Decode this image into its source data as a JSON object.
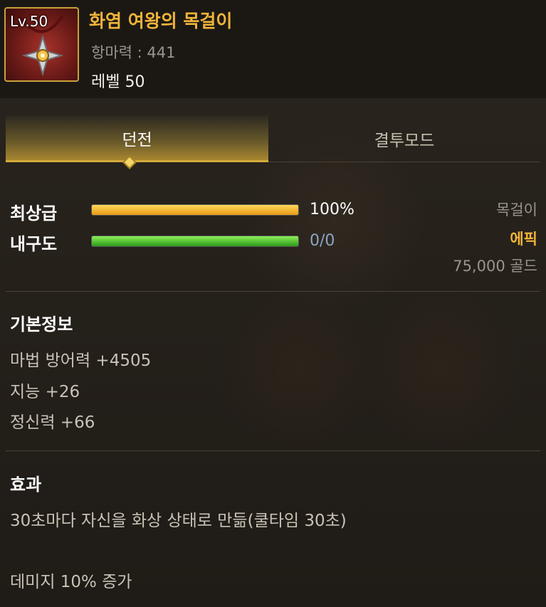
{
  "item": {
    "level_badge": "Lv.50",
    "name": "화염 여왕의 목걸이",
    "resist": "항마력 : 441",
    "level": "레벨 50"
  },
  "tabs": [
    {
      "label": "던전",
      "active": true
    },
    {
      "label": "결투모드",
      "active": false
    }
  ],
  "stats": {
    "top_grade": {
      "label": "최상급",
      "value": "100%",
      "fraction": 1.0,
      "color": "#f0a020"
    },
    "durability": {
      "label": "내구도",
      "value": "0/0",
      "fraction": 1.0,
      "color": "#54d030"
    }
  },
  "info": {
    "type": "목걸이",
    "rarity": "에픽",
    "price": "75,000 골드"
  },
  "basic_info": {
    "title": "기본정보",
    "lines": [
      "마법 방어력 +4505",
      "지능 +26",
      "정신력 +66"
    ]
  },
  "effect": {
    "title": "효과",
    "lines": [
      "30초마다 자신을 화상 상태로 만듦(쿨타임 30초)",
      "데미지 10% 증가"
    ]
  },
  "colors": {
    "name": "#f0b43a",
    "rarity": "#f0b43a",
    "value_durability": "#8aa6c8",
    "accent_tab": "#d4aa3b"
  }
}
